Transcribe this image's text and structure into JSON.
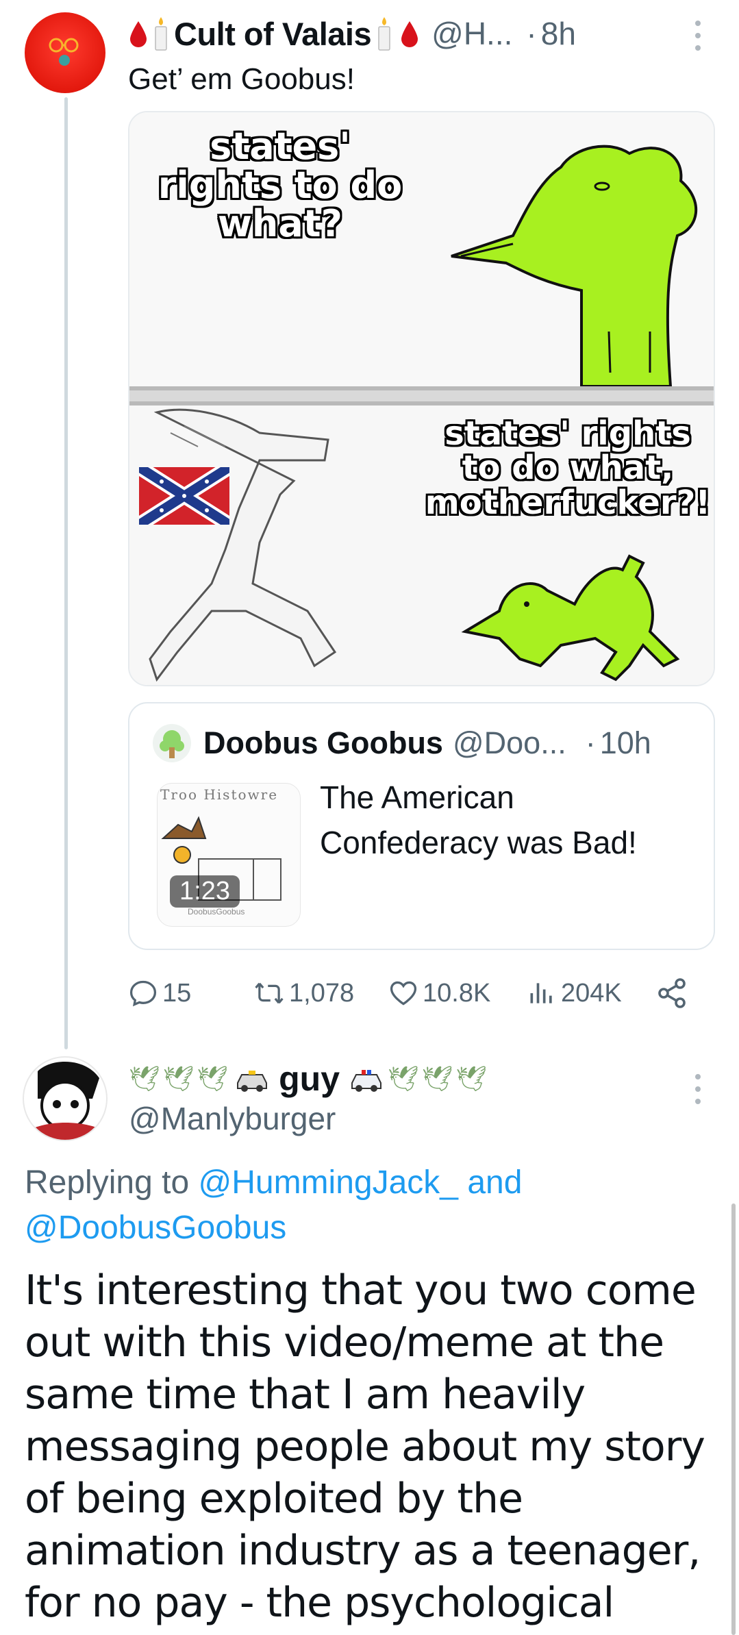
{
  "tweet": {
    "display_name": "Cult of Valais",
    "handle": "@H...",
    "separator": "·",
    "time": "8h",
    "text": "Get’ em Goobus!",
    "meme": {
      "top_text": "states' rights to do what?",
      "bottom_text": "states' rights to do what, motherfucker?!"
    },
    "quote": {
      "display_name": "Doobus Goobus",
      "handle": "@Doo...",
      "separator": "·",
      "time": "10h",
      "text": "The American Confederacy was Bad!",
      "video_duration": "1:23",
      "thumb_caption": "Troo Histowre",
      "thumb_signature": "DoobusGoobus"
    },
    "stats": {
      "replies": "15",
      "reposts": "1,078",
      "likes": "10.8K",
      "views": "204K"
    }
  },
  "reply": {
    "display_name": "guy",
    "handle": "@Manlyburger",
    "replying_prefix": "Replying to ",
    "replying_user1": "@HummingJack_",
    "replying_and": " and",
    "replying_user2": "@DoobusGoobus",
    "text": "It's interesting that you two come out with this video/meme at the same time that I am heavily messaging people about my story of being exploited by the animation industry as a teenager, for no pay - the psychological motivation perhaps?"
  },
  "colors": {
    "link": "#1d9bf0",
    "secondary_text": "#536471",
    "goobus_green": "#a8f020",
    "confederate_red": "#d2232a",
    "confederate_blue": "#1f3a8c"
  }
}
